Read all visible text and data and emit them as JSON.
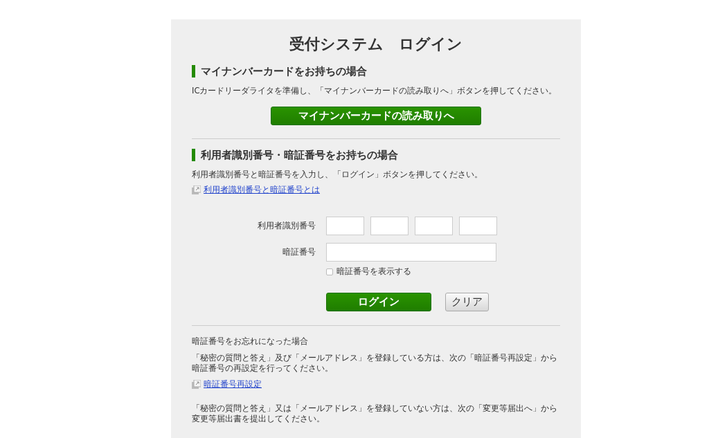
{
  "title": "受付システム　ログイン",
  "mynumber_section": {
    "heading": "マイナンバーカードをお持ちの場合",
    "text": "ICカードリーダライタを準備し、「マイナンバーカードの読み取りへ」ボタンを押してください。",
    "button": "マイナンバーカードの読み取りへ"
  },
  "id_section": {
    "heading": "利用者識別番号・暗証番号をお持ちの場合",
    "text": "利用者識別番号と暗証番号を入力し、「ログイン」ボタンを押してください。",
    "link": "利用者識別番号と暗証番号とは",
    "user_id_label": "利用者識別番号",
    "password_label": "暗証番号",
    "show_password": {
      "label": "暗証番号を表示する",
      "checked": false
    },
    "login_button": "ログイン",
    "clear_button": "クリア"
  },
  "forgot_section": {
    "heading": "暗証番号をお忘れになった場合",
    "text_1": "「秘密の質問と答え」及び「メールアドレス」を登録している方は、次の「暗証番号再設定」から暗証番号の再設定を行ってください。",
    "link": "暗証番号再設定",
    "text_2": "「秘密の質問と答え」又は「メールアドレス」を登録していない方は、次の「変更等届出へ」から変更等届出書を提出してください。"
  }
}
